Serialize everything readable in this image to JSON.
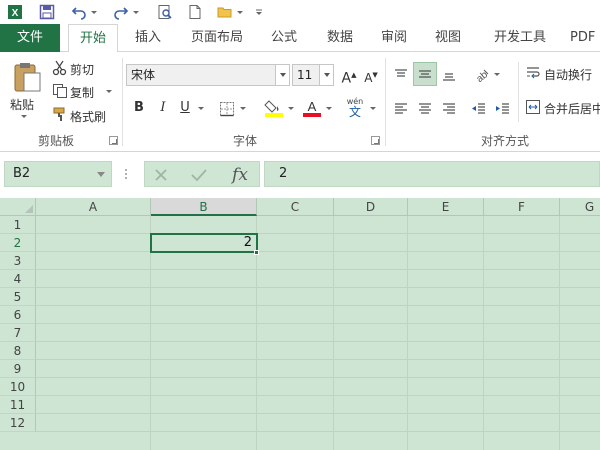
{
  "qat": {
    "icons": [
      "excel-logo-icon",
      "save-icon",
      "undo-icon",
      "redo-icon",
      "print-preview-icon",
      "new-document-icon",
      "open-folder-icon",
      "customize-toolbar-icon"
    ]
  },
  "tabs": [
    {
      "label": "文件"
    },
    {
      "label": "开始"
    },
    {
      "label": "插入"
    },
    {
      "label": "页面布局"
    },
    {
      "label": "公式"
    },
    {
      "label": "数据"
    },
    {
      "label": "审阅"
    },
    {
      "label": "视图"
    },
    {
      "label": "开发工具"
    },
    {
      "label": "PDF"
    }
  ],
  "clipboard": {
    "paste_label": "粘贴",
    "cut_label": "剪切",
    "copy_label": "复制",
    "format_painter_label": "格式刷",
    "group_label": "剪贴板"
  },
  "font": {
    "font_name": "宋体",
    "font_size": "11",
    "bold": "B",
    "italic": "I",
    "underline": "U",
    "font_color_glyph": "A",
    "phonetic_glyph": "wén",
    "phonetic_sub": "文",
    "grow_glyph": "A",
    "shrink_glyph": "A",
    "group_label": "字体",
    "accent_fill": "#ffff00",
    "accent_font": "#e81123"
  },
  "alignment": {
    "wrap_text_label": "自动换行",
    "merge_center_label": "合并后居中",
    "group_label": "对齐方式"
  },
  "formula_bar": {
    "name_box": "B2",
    "fx_label": "fx",
    "value": "2"
  },
  "sheet": {
    "columns": [
      "A",
      "B",
      "C",
      "D",
      "E",
      "F",
      "G"
    ],
    "rows": [
      "1",
      "2",
      "3",
      "4",
      "5",
      "6",
      "7",
      "8",
      "9",
      "10",
      "11",
      "12"
    ],
    "active_cell_value": "2",
    "accent": "#217346",
    "grid_bg": "#cde5d2"
  }
}
